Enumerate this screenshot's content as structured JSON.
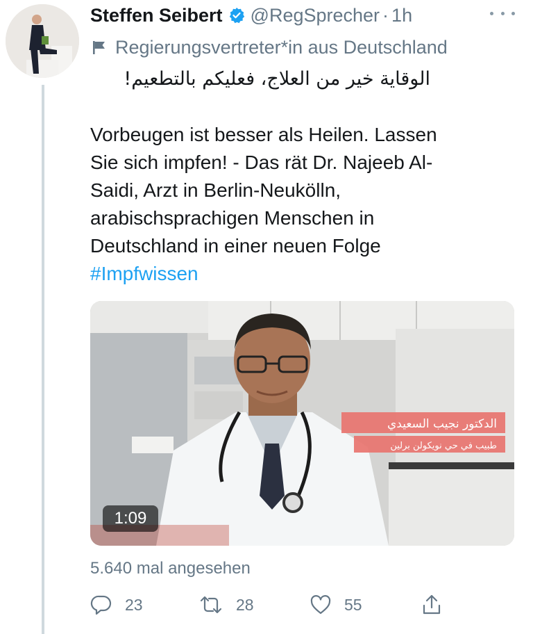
{
  "tweet": {
    "author_name": "Steffen Seibert",
    "handle": "@RegSprecher",
    "separator": "·",
    "time": "1h",
    "label": "Regierungsvertreter*in aus Deutschland",
    "arabic_text": "الوقاية خير من العلاج، فعليكم بالتطعيم!",
    "text_lines": [
      "Vorbeugen ist besser als Heilen. Lassen",
      "Sie sich impfen! - Das rät Dr. Najeeb Al-",
      "Saidi, Arzt in Berlin-Neukölln,",
      "arabischsprachigen Menschen in",
      "Deutschland in einer neuen Folge"
    ],
    "hashtag": "#Impfwissen",
    "views": "5.640 mal angesehen"
  },
  "video": {
    "duration": "1:09",
    "caption_name": "الدكتور نجيب السعيدي",
    "caption_subtitle": "طبيب في حي نويكولن برلين",
    "caption_color": "#e8746f"
  },
  "actions": {
    "reply_count": "23",
    "retweet_count": "28",
    "like_count": "55"
  },
  "colors": {
    "accent": "#1da1f2",
    "verified": "#1da1f2",
    "secondary_text": "#657786"
  },
  "icons": [
    "verified-badge-icon",
    "more-icon",
    "flag-icon",
    "reply-icon",
    "retweet-icon",
    "like-icon",
    "share-icon"
  ]
}
